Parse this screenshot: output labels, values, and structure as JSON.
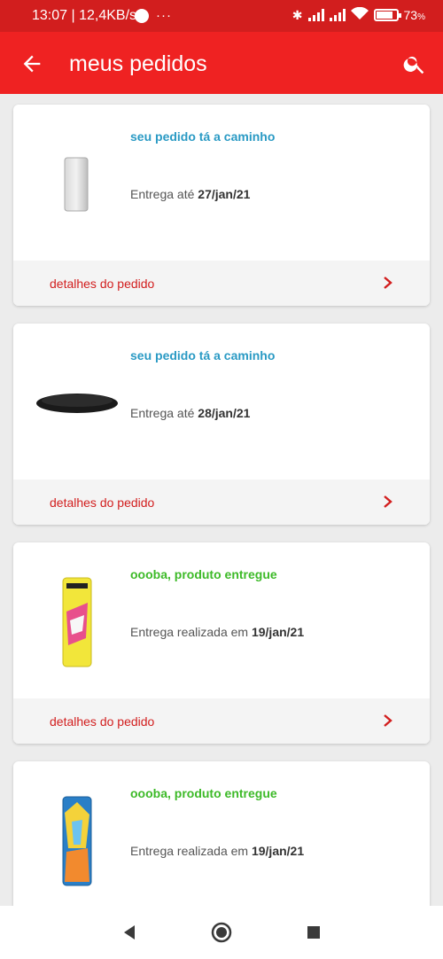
{
  "status_bar": {
    "time": "13:07 | 12,4KB/s",
    "more": "···",
    "battery": "73"
  },
  "app_bar": {
    "title": "meus pedidos",
    "back_icon": "arrow-left-icon",
    "search_icon": "search-icon",
    "color": "#ef2222"
  },
  "orders": [
    {
      "status": "seu pedido tá a caminho",
      "delivery_label": "Entrega até",
      "delivery_date": "27/jan/21",
      "link": "detalhes do pedido"
    },
    {
      "status": "seu pedido tá a caminho",
      "delivery_label": "Entrega até",
      "delivery_date": "28/jan/21",
      "link": "detalhes do pedido"
    },
    {
      "status": "oooba, produto entregue",
      "delivery_label": "Entrega realizada em",
      "delivery_date": "19/jan/21",
      "link": "detalhes do pedido"
    },
    {
      "status": "oooba, produto entregue",
      "delivery_label": "Entrega realizada em",
      "delivery_date": "19/jan/21"
    }
  ],
  "colors": {
    "status_in_transit": "#2a9ac4",
    "status_delivered": "#3dba28",
    "link": "#d21e1e"
  }
}
